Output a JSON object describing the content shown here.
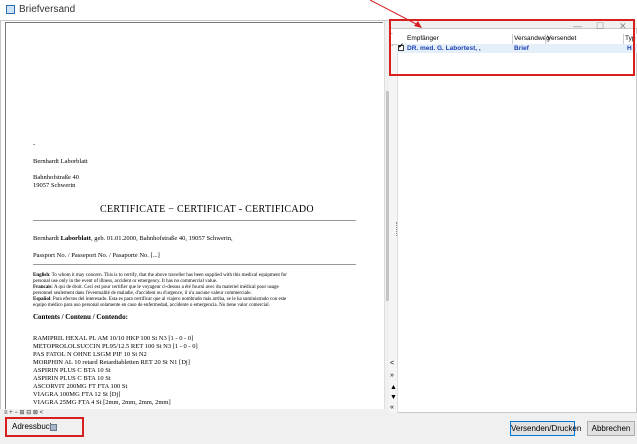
{
  "window": {
    "title": "Briefversand",
    "controls": [
      "—",
      "☐",
      "✕"
    ]
  },
  "document": {
    "dash": "-",
    "name": "Bernhardt Laborblatt",
    "street": "Bahnhofstraße 40",
    "city": "19057 Schwerin",
    "heading": "CERTIFICATE − CERTIFICAT - CERTIFICADO",
    "patient_prefix": "Bernhardt ",
    "patient_bold": "Laborblatt",
    "patient_rest": ", geb. 01.01.2000, Bahnhofstraße 40, 19057 Schwerin,",
    "passport": "Passport No. / Passeport No. / Pasaporte No. [...]",
    "english_label": "English",
    "english_text": ": To whom it may concern. This is to certify, that the above traveller has been supplied with this medical equipment for",
    "english_text2": "personal use only in the event of illness, accident or emergency. It has no commercial value.",
    "french_label": "Francais",
    "french_text": ": A qui de droit. Ceci est pour certifier que le voyageur ci-dessus a été fourni avec du materiel médical pour usage",
    "french_text2": "personnel seulement dans l'éventualité de maladie, d'accident ou d'urgence, il n'a aucune valeur commerciale.",
    "spanish_label": "Español",
    "spanish_text": ": Para efectos del interesado. Esta es para certificar que al viajero nombrado más arriba, se le ha suministrado con este",
    "spanish_text2": "equipo médico para uso personal solamente en caso de enfermedad, accidente o emergencia. No tiene valor comercial.",
    "contents_heading": "Contents / Contenu / Contendo:",
    "medications": [
      "RAMIPRIL HEXAL PL AM 10/10 HKP 100 St N3 [1 - 0 - 0]",
      "METOPROLOLSUCCIN PL95/12.5 RET 100 St N3 [1 - 0 - 0]",
      "PAS FATOL N OHNE LSGM PIF 10 St N2",
      "MORPHIN AL 10 retard Retardtabletten RET 20 St N1 [Dj]",
      "ASPIRIN PLUS C BTA 10 St",
      "ASPIRIN PLUS C BTA 10 St",
      "ASCORVIT 200MG FT FTA 100 St",
      "VIAGRA 100MG FTA 12 St [Dj]",
      "VIAGRA 25MG FTA 4 St [2mm, 2mm, 2mm, 2mm]"
    ],
    "toolbar_glyphs": "≡ + − ⊞ ⊟ ⊠ <"
  },
  "recipients": {
    "columns": [
      "Empfänger",
      "Versandweg",
      "Versendet",
      "Typ"
    ],
    "left_markers": {
      "question": "?",
      "up": "^"
    },
    "rows": [
      {
        "empfaenger": "DR. med. G. Labortest, ,",
        "versandweg": "Brief",
        "versendet": "",
        "typ": "H",
        "checked": true
      }
    ],
    "side_glyphs": [
      "<",
      "»",
      "▲",
      "▼",
      "«"
    ]
  },
  "footer": {
    "adressbuch_label": "Adressbuch",
    "send_label": "Versenden/Drucken",
    "cancel_label": "Abbrechen"
  }
}
